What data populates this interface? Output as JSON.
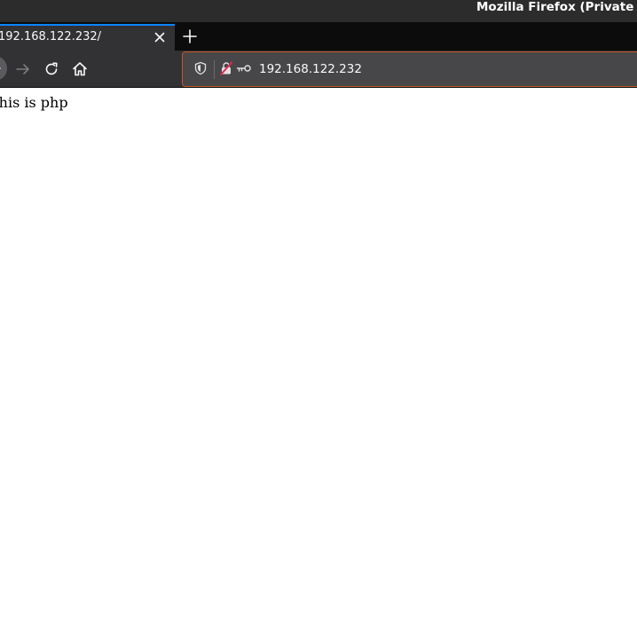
{
  "window": {
    "title": "Mozilla Firefox (Private Browsing)"
  },
  "tabs": [
    {
      "title": "192.168.122.232/",
      "active": true,
      "close_icon": "close-icon"
    }
  ],
  "toolbar": {
    "back_icon": "back-arrow-icon",
    "forward_icon": "forward-arrow-icon",
    "reload_icon": "reload-icon",
    "home_icon": "home-icon",
    "new_tab_icon": "plus-icon"
  },
  "urlbar": {
    "value": "192.168.122.232",
    "icons": [
      "tracking-protection-shield-icon",
      "insecure-connection-lock-icon",
      "key-icon"
    ],
    "focus_border_color": "#c25a26"
  },
  "page": {
    "text": "This is php"
  },
  "colors": {
    "titlebar": "#2c2c2c",
    "tabstrip": "#0c0c0d",
    "active_tab": "#323234",
    "tab_accent": "#0a84ff",
    "urlbar_bg": "#474749"
  }
}
